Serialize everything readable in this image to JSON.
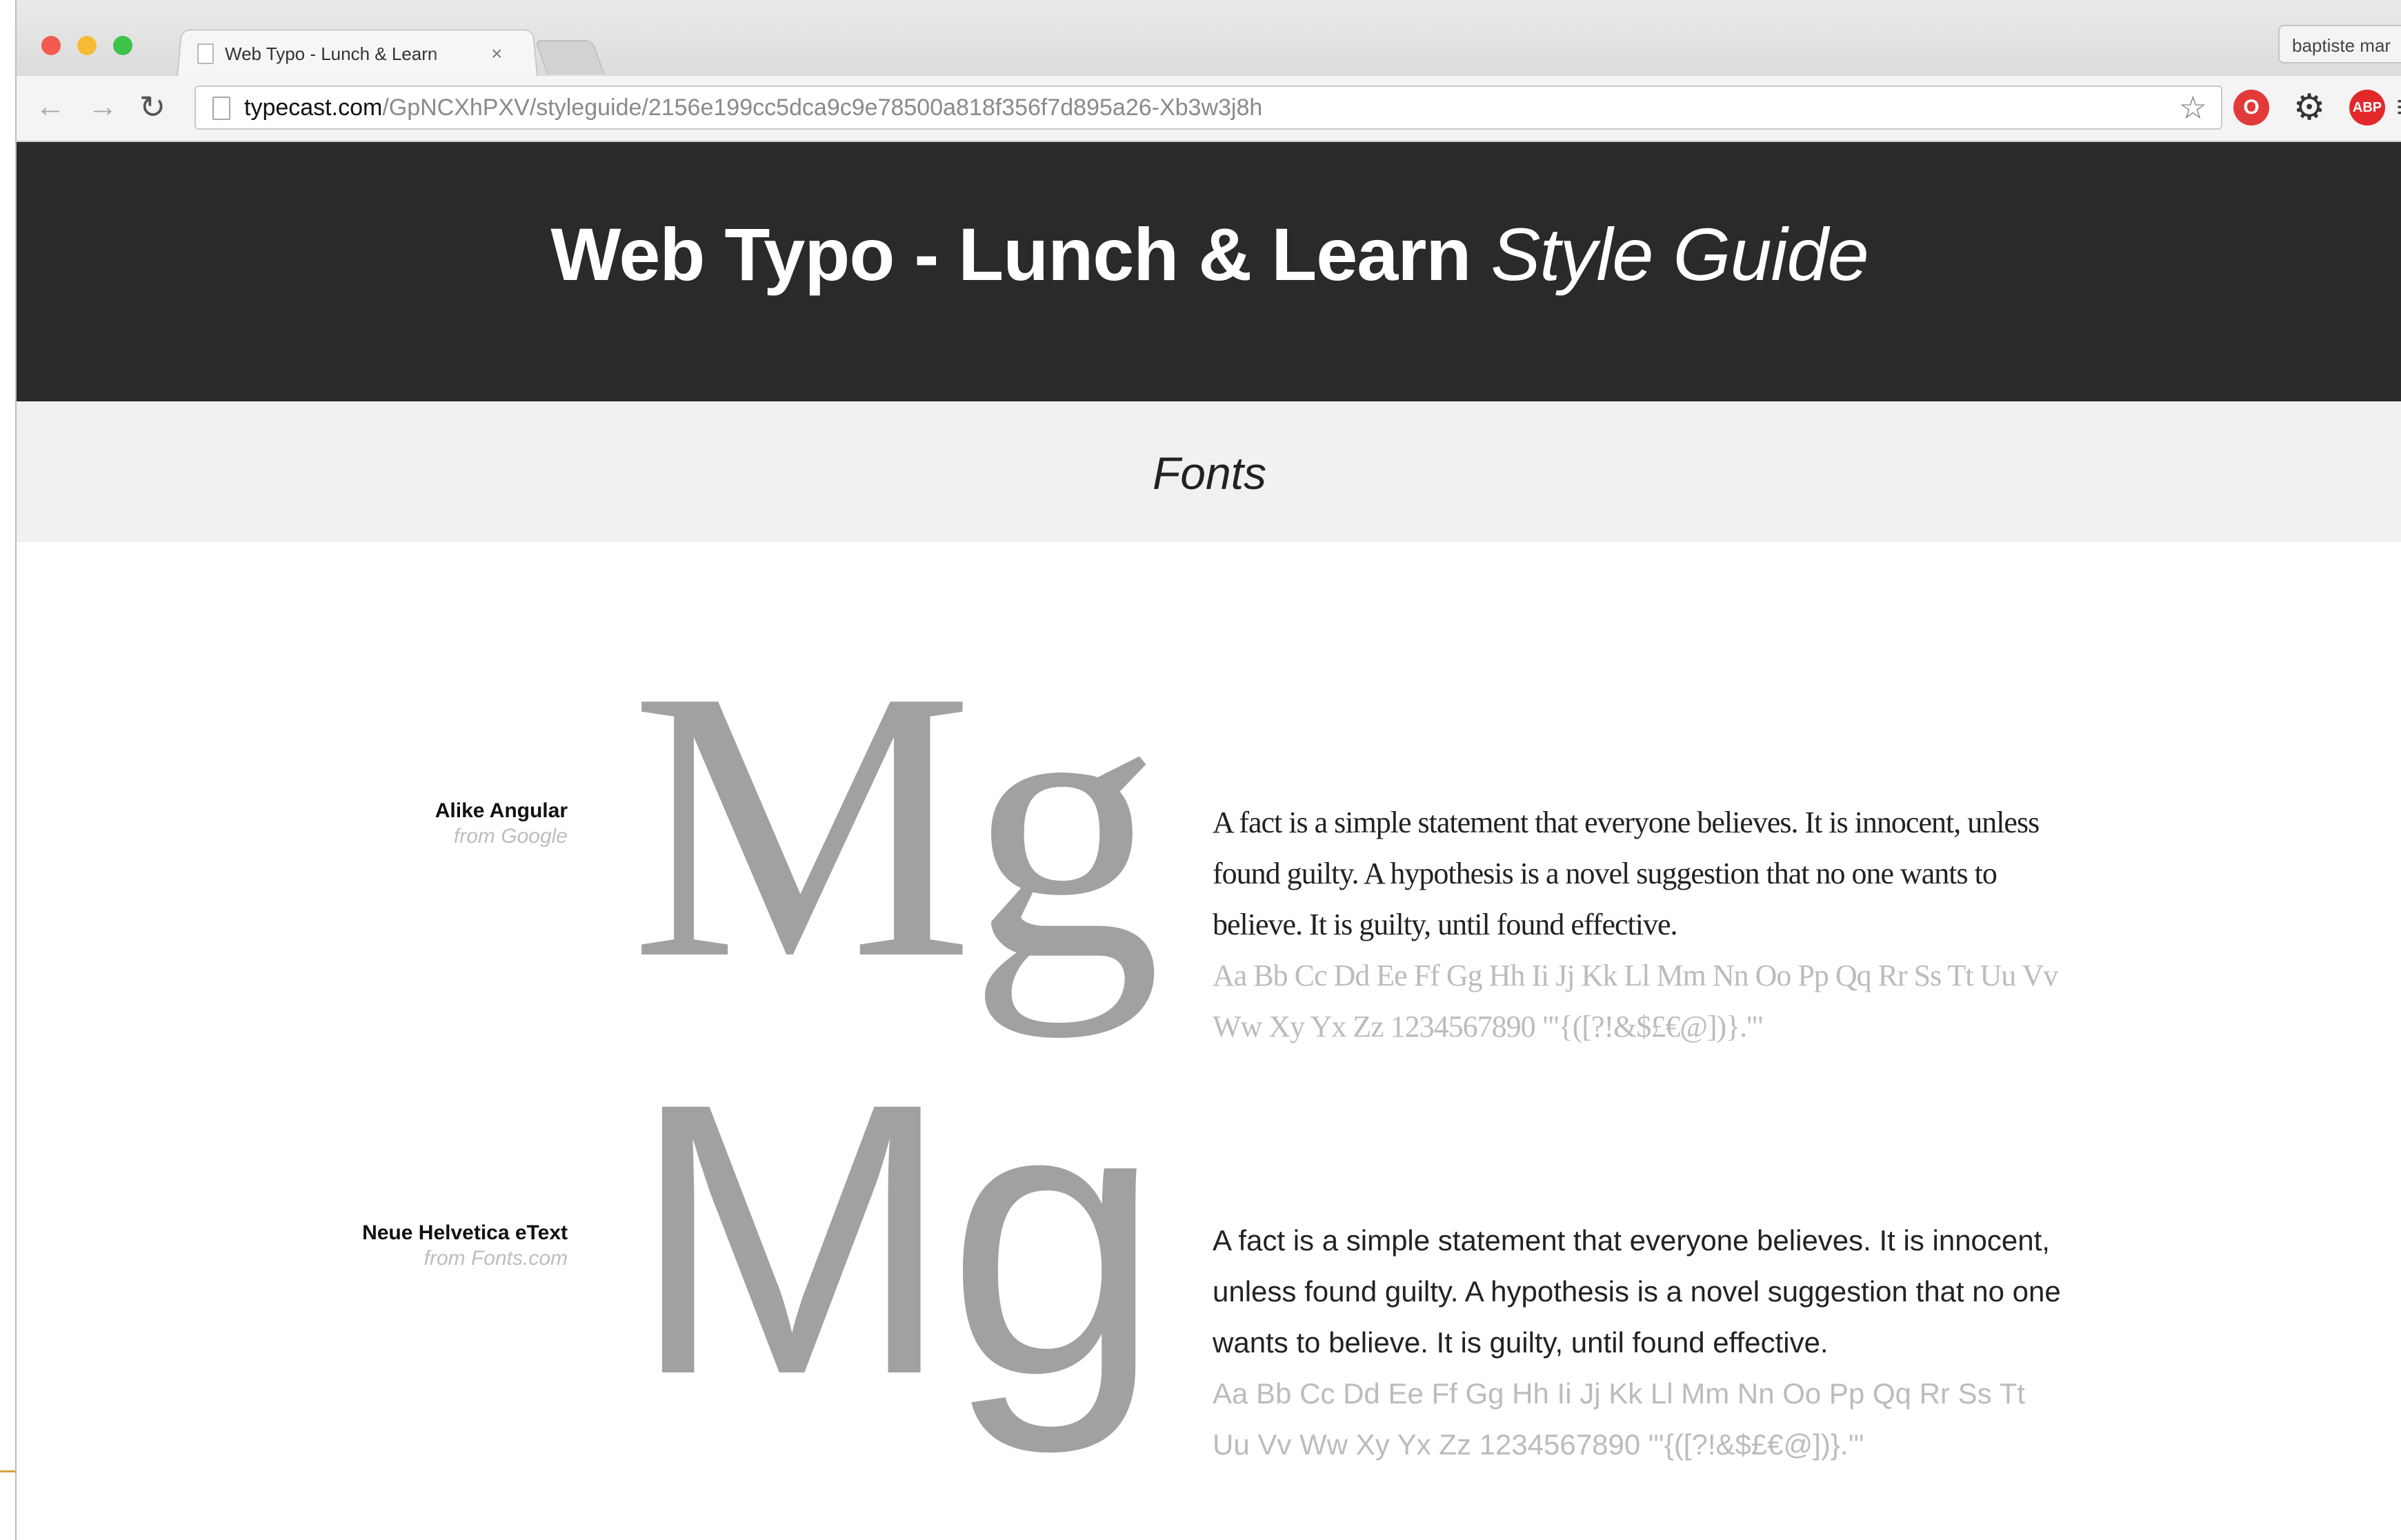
{
  "browser": {
    "tab_title": "Web Typo - Lunch & Learn",
    "tab_close": "×",
    "user_label": "baptiste mar",
    "url_host": "typecast.com",
    "url_path": "/GpNCXhPXV/styleguide/2156e199cc5dca9c9e78500a818f356f7d895a26-Xb3w3j8h",
    "icons": {
      "back": "←",
      "forward": "→",
      "reload": "↻",
      "star": "☆",
      "gear": "⚙",
      "menu": "≡",
      "opera": "O",
      "abp": "ABP"
    }
  },
  "header": {
    "title_main": "Web Typo - Lunch & Learn ",
    "title_italic": "Style Guide"
  },
  "section": {
    "title": "Fonts"
  },
  "fonts": [
    {
      "name": "Alike Angular",
      "source": "from Google",
      "glyphs": "Mg",
      "sample": "A fact is a simple statement that everyone believes. It is innocent, unless found guilty. A hypothesis is a novel suggestion that no one wants to believe. It is guilty, until found effective.",
      "alphabet": "Aa Bb Cc Dd Ee Ff Gg Hh Ii Jj Kk Ll Mm Nn Oo Pp Qq Rr Ss Tt Uu Vv Ww Xy Yx Zz 1234567890 \"'{([?!&$£€@])}.'\""
    },
    {
      "name": "Neue Helvetica eText",
      "source": "from Fonts.com",
      "glyphs": "Mg",
      "sample": "A fact is a simple statement that everyone believes. It is innocent, unless found guilty. A hypothesis is a novel suggestion that no one wants to believe. It is guilty, until found effective.",
      "alphabet": "Aa Bb Cc Dd Ee Ff Gg Hh Ii Jj Kk Ll Mm Nn Oo Pp Qq Rr Ss Tt Uu Vv Ww Xy Yx Zz 1234567890 \"'{([?!&$£€@])}.'\""
    }
  ]
}
